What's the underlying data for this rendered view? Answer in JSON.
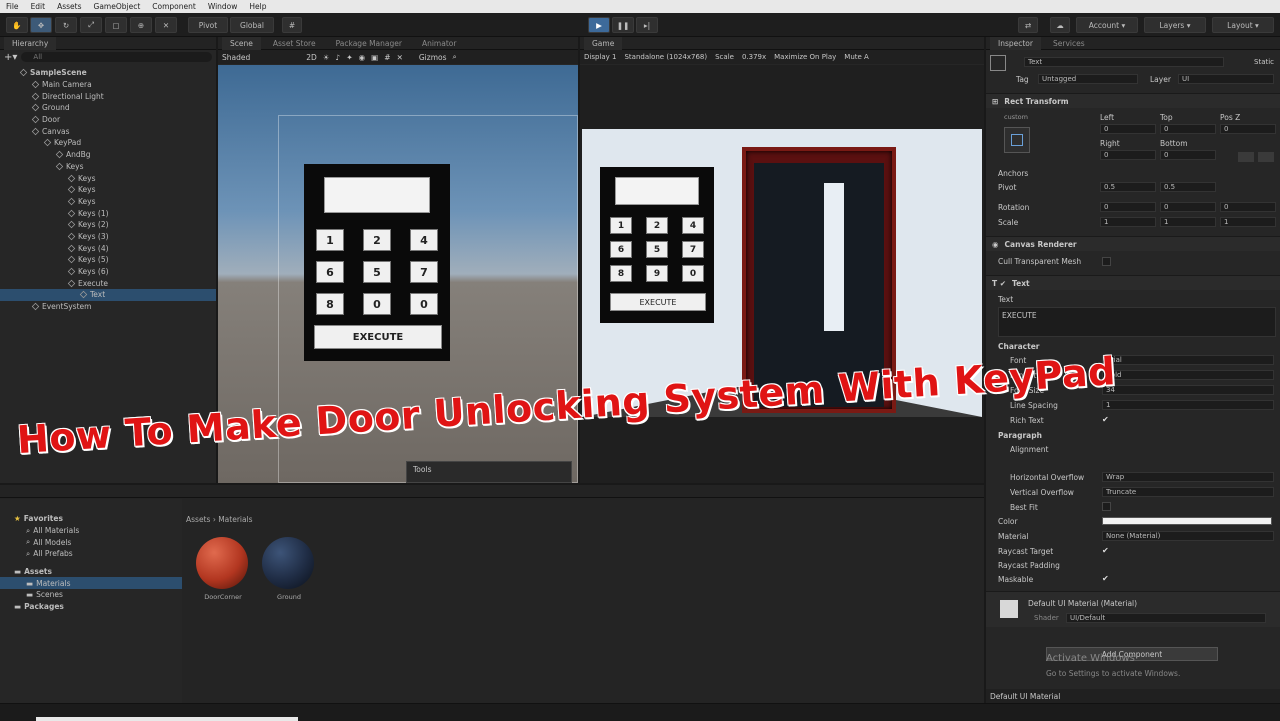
{
  "menu": [
    "File",
    "Edit",
    "Assets",
    "GameObject",
    "Component",
    "Window",
    "Help"
  ],
  "toolbar": {
    "pivot": "Pivot",
    "global": "Global",
    "account": "Account",
    "layers": "Layers",
    "layout": "Layout"
  },
  "hierarchy": {
    "tab": "Hierarchy",
    "search_placeholder": "All",
    "items": [
      {
        "label": "SampleScene",
        "indent": 0,
        "bold": true
      },
      {
        "label": "Main Camera",
        "indent": 1
      },
      {
        "label": "Directional Light",
        "indent": 1
      },
      {
        "label": "Ground",
        "indent": 1
      },
      {
        "label": "Door",
        "indent": 1
      },
      {
        "label": "Canvas",
        "indent": 1
      },
      {
        "label": "KeyPad",
        "indent": 2
      },
      {
        "label": "AndBg",
        "indent": 3
      },
      {
        "label": "Keys",
        "indent": 3
      },
      {
        "label": "Keys",
        "indent": 4
      },
      {
        "label": "Keys",
        "indent": 4
      },
      {
        "label": "Keys",
        "indent": 4
      },
      {
        "label": "Keys (1)",
        "indent": 4
      },
      {
        "label": "Keys (2)",
        "indent": 4
      },
      {
        "label": "Keys (3)",
        "indent": 4
      },
      {
        "label": "Keys (4)",
        "indent": 4
      },
      {
        "label": "Keys (5)",
        "indent": 4
      },
      {
        "label": "Keys (6)",
        "indent": 4
      },
      {
        "label": "Execute",
        "indent": 4
      },
      {
        "label": "Text",
        "indent": 5,
        "selected": true
      },
      {
        "label": "EventSystem",
        "indent": 1
      }
    ]
  },
  "scene": {
    "tabs": [
      "Scene",
      "Asset Store",
      "Package Manager",
      "Animator"
    ],
    "shading": "Shaded",
    "mode_2d": "2D",
    "gizmos": "Gizmos",
    "keys": [
      "1",
      "2",
      "4",
      "6",
      "5",
      "7",
      "8",
      "0",
      "0"
    ],
    "execute": "EXECUTE",
    "tools_label": "Tools"
  },
  "game": {
    "tab": "Game",
    "display": "Display 1",
    "resolution": "Standalone (1024x768)",
    "scale": "Scale",
    "scale_value": "0.379x",
    "maximize": "Maximize On Play",
    "mute": "Mute A",
    "keys": [
      "1",
      "2",
      "4",
      "6",
      "5",
      "7",
      "8",
      "9",
      "0"
    ],
    "execute": "EXECUTE"
  },
  "project": {
    "favorites": "Favorites",
    "fav_items": [
      "All Materials",
      "All Models",
      "All Prefabs"
    ],
    "assets": "Assets",
    "asset_items": [
      "Materials",
      "Scenes"
    ],
    "packages": "Packages",
    "breadcrumb_root": "Assets",
    "breadcrumb_sep": "›",
    "breadcrumb_leaf": "Materials",
    "materials": [
      {
        "name": "DoorCorner",
        "color": "#b23620"
      },
      {
        "name": "Ground",
        "color": "#1f2c44"
      }
    ]
  },
  "inspector": {
    "tabs": [
      "Inspector",
      "Services"
    ],
    "object_name": "Text",
    "static": "Static",
    "tag_label": "Tag",
    "tag_value": "Untagged",
    "layer_label": "Layer",
    "layer_value": "UI",
    "rect_transform": "Rect Transform",
    "custom": "custom",
    "left": "Left",
    "top": "Top",
    "posz": "Pos Z",
    "left_val": "0",
    "top_val": "0",
    "posz_val": "0",
    "right": "Right",
    "bottom": "Bottom",
    "right_val": "0",
    "bottom_val": "0",
    "anchors": "Anchors",
    "pivot": "Pivot",
    "pivot_x": "0.5",
    "pivot_y": "0.5",
    "rotation": "Rotation",
    "rot_x": "0",
    "rot_y": "0",
    "rot_z": "0",
    "scale": "Scale",
    "scale_x": "1",
    "scale_y": "1",
    "scale_z": "1",
    "canvas_renderer": "Canvas Renderer",
    "cull": "Cull Transparent Mesh",
    "text_comp": "Text",
    "text_label": "Text",
    "text_value": "EXECUTE",
    "character": "Character",
    "font": "Font",
    "font_value": "Arial",
    "font_style": "Font Style",
    "font_style_value": "Bold",
    "font_size": "Font Size",
    "font_size_value": "34",
    "line_spacing": "Line Spacing",
    "line_spacing_value": "1",
    "rich_text": "Rich Text",
    "paragraph": "Paragraph",
    "alignment": "Alignment",
    "h_overflow": "Horizontal Overflow",
    "h_overflow_value": "Wrap",
    "v_overflow": "Vertical Overflow",
    "v_overflow_value": "Truncate",
    "best_fit": "Best Fit",
    "color": "Color",
    "material": "Material",
    "material_value": "None (Material)",
    "raycast_target": "Raycast Target",
    "raycast_padding": "Raycast Padding",
    "maskable": "Maskable",
    "default_material": "Default UI Material (Material)",
    "shader": "Shader",
    "shader_value": "UI/Default",
    "add_component": "Add Component",
    "activate": "Activate Windows",
    "activate_sub": "Go to Settings to activate Windows.",
    "footer": "Default UI Material"
  },
  "overlay_title": "How To Make Door Unlocking System With KeyPad"
}
